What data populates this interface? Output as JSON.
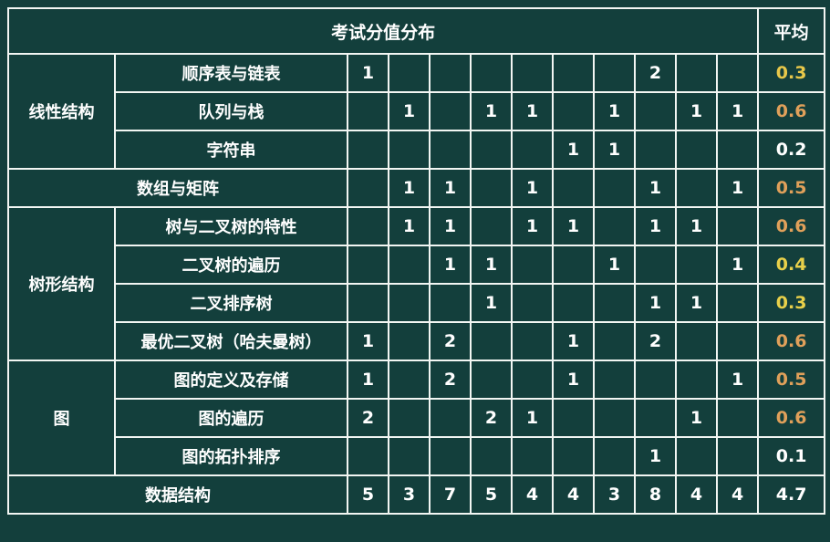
{
  "header": {
    "title": "考试分值分布",
    "avg_label": "平均"
  },
  "groups": [
    {
      "name": "线性结构",
      "rows": [
        0,
        1,
        2
      ]
    },
    {
      "name": "树形结构",
      "rows": [
        4,
        5,
        6,
        7
      ]
    },
    {
      "name": "图",
      "rows": [
        8,
        9,
        10
      ]
    }
  ],
  "rows": [
    {
      "label": "顺序表与链表",
      "cells": [
        "1",
        "",
        "",
        "",
        "",
        "",
        "",
        "2",
        "",
        ""
      ],
      "avg": "0.3",
      "avg_color": "#e8c84a"
    },
    {
      "label": "队列与栈",
      "cells": [
        "",
        "1",
        "",
        "1",
        "1",
        "",
        "1",
        "",
        "1",
        "1"
      ],
      "avg": "0.6",
      "avg_color": "#e0a05a"
    },
    {
      "label": "字符串",
      "cells": [
        "",
        "",
        "",
        "",
        "",
        "1",
        "1",
        "",
        "",
        ""
      ],
      "avg": "0.2",
      "avg_color": "#ffffff"
    },
    {
      "label": "数组与矩阵",
      "cells": [
        "",
        "1",
        "1",
        "",
        "1",
        "",
        "",
        "1",
        "",
        "1"
      ],
      "avg": "0.5",
      "avg_color": "#e0a05a"
    },
    {
      "label": "树与二叉树的特性",
      "cells": [
        "",
        "1",
        "1",
        "",
        "1",
        "1",
        "",
        "1",
        "1",
        ""
      ],
      "avg": "0.6",
      "avg_color": "#e0a05a"
    },
    {
      "label": "二叉树的遍历",
      "cells": [
        "",
        "",
        "1",
        "1",
        "",
        "",
        "1",
        "",
        "",
        "1"
      ],
      "avg": "0.4",
      "avg_color": "#e8d04a"
    },
    {
      "label": "二叉排序树",
      "cells": [
        "",
        "",
        "",
        "1",
        "",
        "",
        "",
        "1",
        "1",
        ""
      ],
      "avg": "0.3",
      "avg_color": "#e8d04a"
    },
    {
      "label": "最优二叉树（哈夫曼树）",
      "cells": [
        "1",
        "",
        "2",
        "",
        "",
        "1",
        "",
        "2",
        "",
        ""
      ],
      "avg": "0.6",
      "avg_color": "#e0a05a"
    },
    {
      "label": "图的定义及存储",
      "cells": [
        "1",
        "",
        "2",
        "",
        "",
        "1",
        "",
        "",
        "",
        "1"
      ],
      "avg": "0.5",
      "avg_color": "#e0a05a"
    },
    {
      "label": "图的遍历",
      "cells": [
        "2",
        "",
        "",
        "2",
        "1",
        "",
        "",
        "",
        "1",
        ""
      ],
      "avg": "0.6",
      "avg_color": "#e0a05a"
    },
    {
      "label": "图的拓扑排序",
      "cells": [
        "",
        "",
        "",
        "",
        "",
        "",
        "",
        "1",
        "",
        ""
      ],
      "avg": "0.1",
      "avg_color": "#ffffff"
    }
  ],
  "total": {
    "label": "数据结构",
    "cells": [
      "5",
      "3",
      "7",
      "5",
      "4",
      "4",
      "3",
      "8",
      "4",
      "4"
    ],
    "avg": "4.7"
  }
}
